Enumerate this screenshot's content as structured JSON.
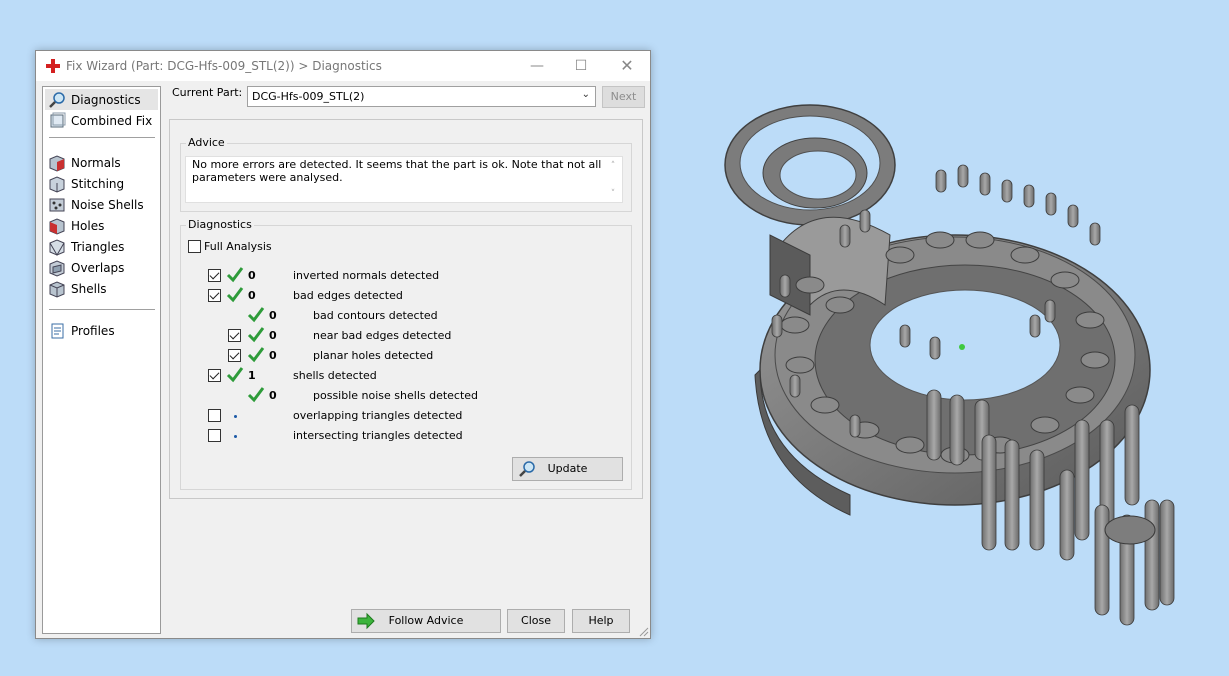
{
  "window": {
    "title": "Fix Wizard (Part: DCG-Hfs-009_STL(2)) > Diagnostics",
    "min_glyph": "—",
    "max_glyph": "☐",
    "close_glyph": "✕"
  },
  "sidebar": {
    "items": [
      {
        "label": "Diagnostics",
        "icon": "magnifier-icon"
      },
      {
        "label": "Combined Fix",
        "icon": "combined-fix-icon"
      },
      {
        "label": "Normals",
        "icon": "normals-icon"
      },
      {
        "label": "Stitching",
        "icon": "stitching-icon"
      },
      {
        "label": "Noise Shells",
        "icon": "noise-shells-icon"
      },
      {
        "label": "Holes",
        "icon": "holes-icon"
      },
      {
        "label": "Triangles",
        "icon": "triangles-icon"
      },
      {
        "label": "Overlaps",
        "icon": "overlaps-icon"
      },
      {
        "label": "Shells",
        "icon": "shells-icon"
      },
      {
        "label": "Profiles",
        "icon": "profiles-icon"
      }
    ]
  },
  "header": {
    "current_part_label": "Current Part:",
    "current_part_value": "DCG-Hfs-009_STL(2)",
    "next_label": "Next"
  },
  "advice": {
    "title": "Advice",
    "text": "No more errors are detected. It seems that the part is ok. Note that not all parameters were analysed."
  },
  "diagnostics": {
    "title": "Diagnostics",
    "full_analysis_label": "Full Analysis",
    "rows": [
      {
        "count": "0",
        "label": "inverted normals detected"
      },
      {
        "count": "0",
        "label": "bad edges detected"
      },
      {
        "count": "0",
        "label": "bad contours detected"
      },
      {
        "count": "0",
        "label": "near bad edges detected"
      },
      {
        "count": "0",
        "label": "planar holes detected"
      },
      {
        "count": "1",
        "label": "shells detected"
      },
      {
        "count": "0",
        "label": "possible noise shells detected"
      },
      {
        "count": "",
        "label": "overlapping triangles detected"
      },
      {
        "count": "",
        "label": "intersecting triangles detected"
      }
    ],
    "update_label": "Update"
  },
  "footer": {
    "follow_advice_label": "Follow Advice",
    "close_label": "Close",
    "help_label": "Help"
  },
  "colors": {
    "accent_green": "#2e9b3a",
    "app_icon_red": "#d42020",
    "viewport_bg": "#bcdcf8"
  }
}
